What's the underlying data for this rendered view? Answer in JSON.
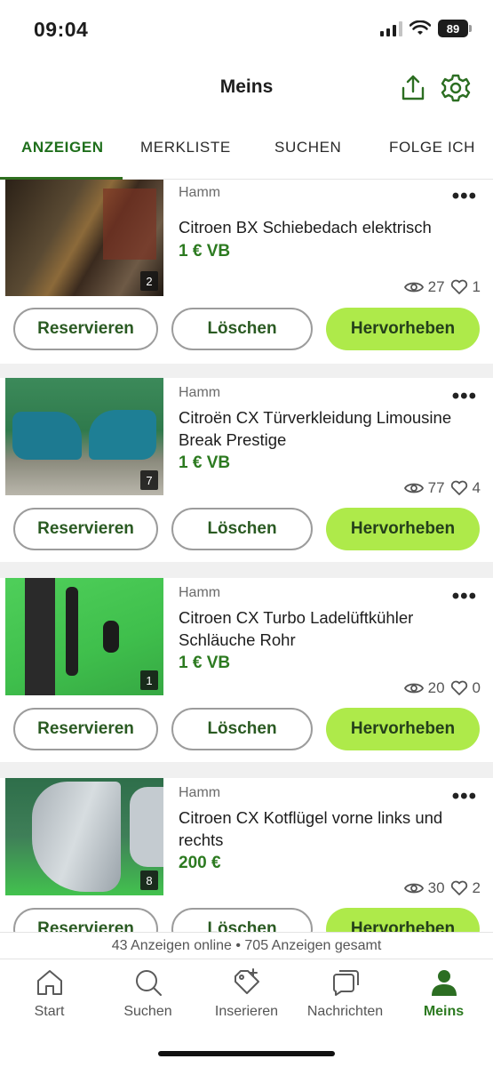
{
  "status": {
    "time": "09:04",
    "battery": "89"
  },
  "header": {
    "title": "Meins"
  },
  "tabs": [
    "ANZEIGEN",
    "MERKLISTE",
    "SUCHEN",
    "FOLGE ICH"
  ],
  "listings": [
    {
      "location": "Hamm",
      "title": "Citroen BX Schiebedach elektrisch",
      "price": "1 € VB",
      "image_count": "2",
      "views": "27",
      "likes": "1"
    },
    {
      "location": "Hamm",
      "title": "Citroën CX Türverkleidung Limousine Break Prestige",
      "price": "1 € VB",
      "image_count": "7",
      "views": "77",
      "likes": "4"
    },
    {
      "location": "Hamm",
      "title": "Citroen CX Turbo Ladelüftkühler Schläuche Rohr",
      "price": "1 € VB",
      "image_count": "1",
      "views": "20",
      "likes": "0"
    },
    {
      "location": "Hamm",
      "title": "Citroen CX Kotflügel vorne links und rechts",
      "price": "200 €",
      "image_count": "8",
      "views": "30",
      "likes": "2"
    }
  ],
  "actions": {
    "reserve": "Reservieren",
    "delete": "Löschen",
    "highlight": "Hervorheben"
  },
  "summary": "43 Anzeigen online • 705 Anzeigen gesamt",
  "nav": [
    {
      "label": "Start",
      "icon": "home-icon"
    },
    {
      "label": "Suchen",
      "icon": "search-icon"
    },
    {
      "label": "Inserieren",
      "icon": "tag-plus-icon"
    },
    {
      "label": "Nachrichten",
      "icon": "chat-icon"
    },
    {
      "label": "Meins",
      "icon": "user-icon"
    }
  ],
  "colors": {
    "accent_green": "#2c7a20",
    "button_lime": "#aeea4a"
  }
}
